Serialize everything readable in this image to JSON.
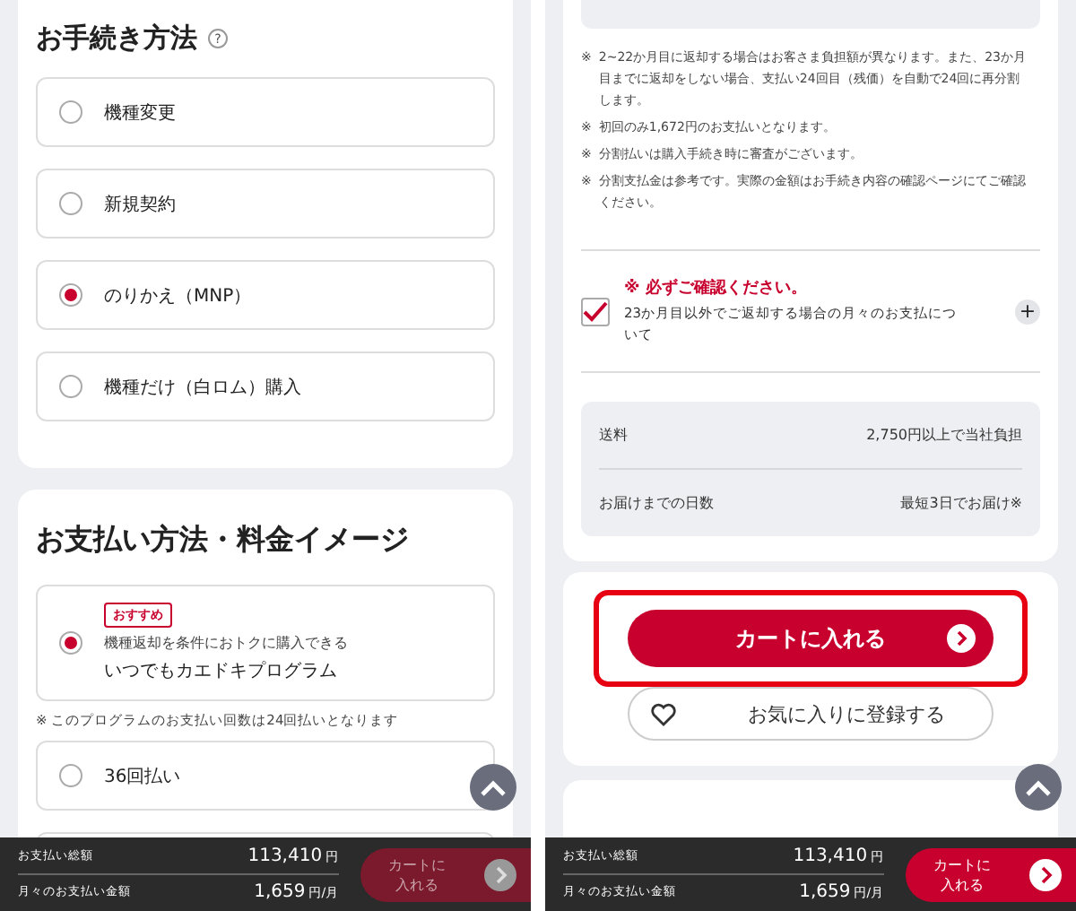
{
  "left_screen": {
    "procedure": {
      "title": "お手続き方法",
      "help_icon": "?",
      "options": [
        {
          "label": "機種変更",
          "selected": false
        },
        {
          "label": "新規契約",
          "selected": false
        },
        {
          "label": "のりかえ（MNP）",
          "selected": true
        },
        {
          "label": "機種だけ（白ロム）購入",
          "selected": false
        }
      ]
    },
    "payment": {
      "title": "お支払い方法・料金イメージ",
      "program": {
        "badge": "おすすめ",
        "caption": "機種返却を条件におトクに購入できる",
        "label": "いつでもカエドキプログラム",
        "selected": true
      },
      "note": "※ このプログラムのお支払い回数は24回払いとなります",
      "installments": [
        {
          "label": "36回払い",
          "selected": false
        }
      ]
    },
    "footer": {
      "total_label": "お支払い総額",
      "total": "113,410",
      "total_unit": "円",
      "monthly_label": "月々のお支払い金額",
      "monthly": "1,659",
      "monthly_unit": "円/月",
      "cart_lines": [
        "カートに",
        "入れる"
      ],
      "disabled": true
    }
  },
  "right_screen": {
    "notes": [
      {
        "mark": "※",
        "text": "2~22か月目に返却する場合はお客さま負担額が異なります。また、23か月目までに返却をしない場合、支払い24回目（残価）を自動で24回に再分割します。"
      },
      {
        "mark": "※",
        "text": "初回のみ1,672円のお支払いとなります。"
      },
      {
        "mark": "※",
        "text": "分割払いは購入手続き時に審査がございます。"
      },
      {
        "mark": "※",
        "text": "分割支払金は参考です。実際の金額はお手続き内容の確認ページにてご確認ください。"
      }
    ],
    "confirm": {
      "heading": "※ 必ずご確認ください。",
      "text": "23か月目以外でご返却する場合の月々のお支払について",
      "checked": true,
      "expand": "+"
    },
    "delivery": [
      {
        "label": "送料",
        "value": "2,750円以上で当社負担"
      },
      {
        "label": "お届けまでの日数",
        "value": "最短3日でお届け※"
      }
    ],
    "cart_button": "カートに入れる",
    "highlighted": true,
    "favorite_button": "お気に入りに登録する",
    "footer": {
      "total_label": "お支払い総額",
      "total": "113,410",
      "total_unit": "円",
      "monthly_label": "月々のお支払い金額",
      "monthly": "1,659",
      "monthly_unit": "円/月",
      "cart_lines": [
        "カートに",
        "入れる"
      ],
      "disabled": false
    }
  }
}
